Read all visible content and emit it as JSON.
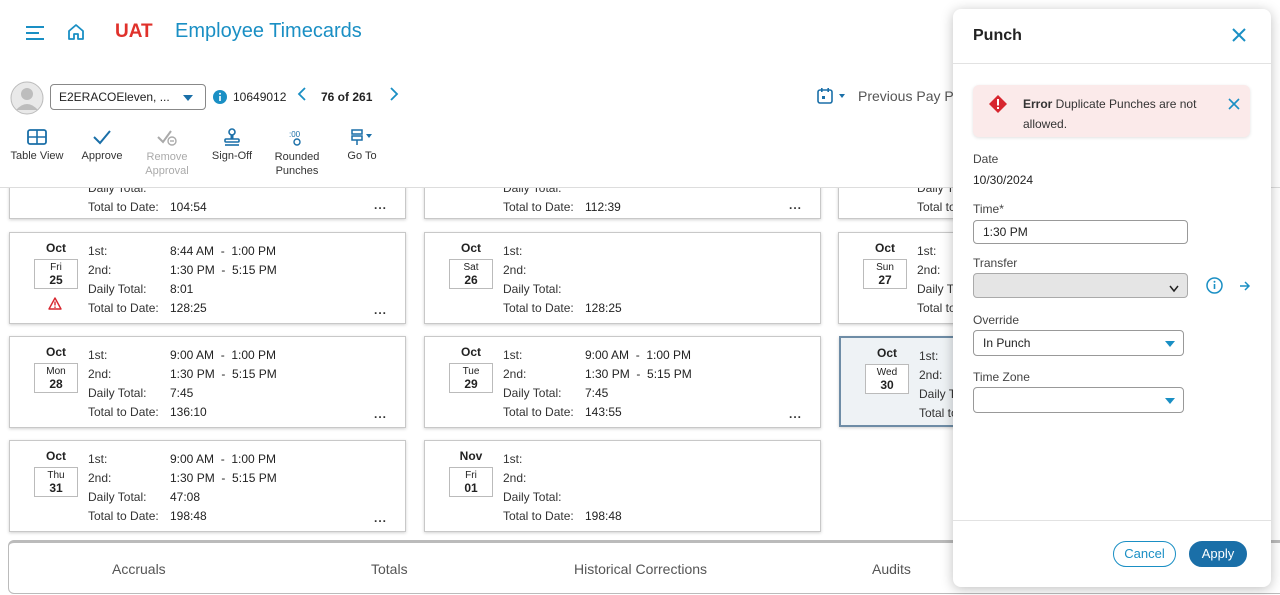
{
  "header": {
    "env": "UAT",
    "title": "Employee Timecards"
  },
  "employee": {
    "name": "E2ERACOEleven, ...",
    "id": "10649012",
    "position": "76 of 261",
    "period": "Previous Pay P"
  },
  "toolbar": {
    "table_view": "Table View",
    "approve": "Approve",
    "remove_approval_1": "Remove",
    "remove_approval_2": "Approval",
    "sign_off": "Sign-Off",
    "rounded_1": "Rounded",
    "rounded_2": "Punches",
    "go_to": "Go To"
  },
  "labels": {
    "first": "1st:",
    "second": "2nd:",
    "daily_total": "Daily Total:",
    "total_to_date": "Total to Date:",
    "dots": "..."
  },
  "cards": {
    "c0": {
      "ttd": "104:54"
    },
    "c1": {
      "ttd": "112:39"
    },
    "c3": {
      "month": "Oct",
      "dow": "Fri",
      "day": "25",
      "first": "8:44 AM  -  1:00 PM",
      "second": "1:30 PM  -  5:15 PM",
      "daily": "8:01",
      "ttd": "128:25"
    },
    "c4": {
      "month": "Oct",
      "dow": "Sat",
      "day": "26",
      "first": "",
      "second": "",
      "daily": "",
      "ttd": "128:25"
    },
    "c5": {
      "month": "Oct",
      "dow": "Sun",
      "day": "27"
    },
    "c6": {
      "month": "Oct",
      "dow": "Mon",
      "day": "28",
      "first": "9:00 AM  -  1:00 PM",
      "second": "1:30 PM  -  5:15 PM",
      "daily": "7:45",
      "ttd": "136:10"
    },
    "c7": {
      "month": "Oct",
      "dow": "Tue",
      "day": "29",
      "first": "9:00 AM  -  1:00 PM",
      "second": "1:30 PM  -  5:15 PM",
      "daily": "7:45",
      "ttd": "143:55"
    },
    "c8": {
      "month": "Oct",
      "dow": "Wed",
      "day": "30"
    },
    "c9": {
      "month": "Oct",
      "dow": "Thu",
      "day": "31",
      "first": "9:00 AM  -  1:00 PM",
      "second": "1:30 PM  -  5:15 PM",
      "daily": "47:08",
      "ttd": "198:48"
    },
    "c10": {
      "month": "Nov",
      "dow": "Fri",
      "day": "01",
      "first": "",
      "second": "",
      "daily": "",
      "ttd": "198:48"
    }
  },
  "tabs": [
    "Accruals",
    "Totals",
    "Historical Corrections",
    "Audits"
  ],
  "panel": {
    "title": "Punch",
    "error_strong": "Error",
    "error_msg": " Duplicate Punches are not allowed.",
    "date_label": "Date",
    "date_value": "10/30/2024",
    "time_label": "Time*",
    "time_value": "1:30 PM",
    "transfer_label": "Transfer",
    "transfer_value": "",
    "override_label": "Override",
    "override_value": "In Punch",
    "tz_label": "Time Zone",
    "tz_value": "",
    "cancel": "Cancel",
    "apply": "Apply"
  },
  "colors": {
    "brand": "#1a8fc4",
    "env": "#e0312b",
    "error": "#d7262f",
    "primary_button": "#1a6fa8"
  }
}
